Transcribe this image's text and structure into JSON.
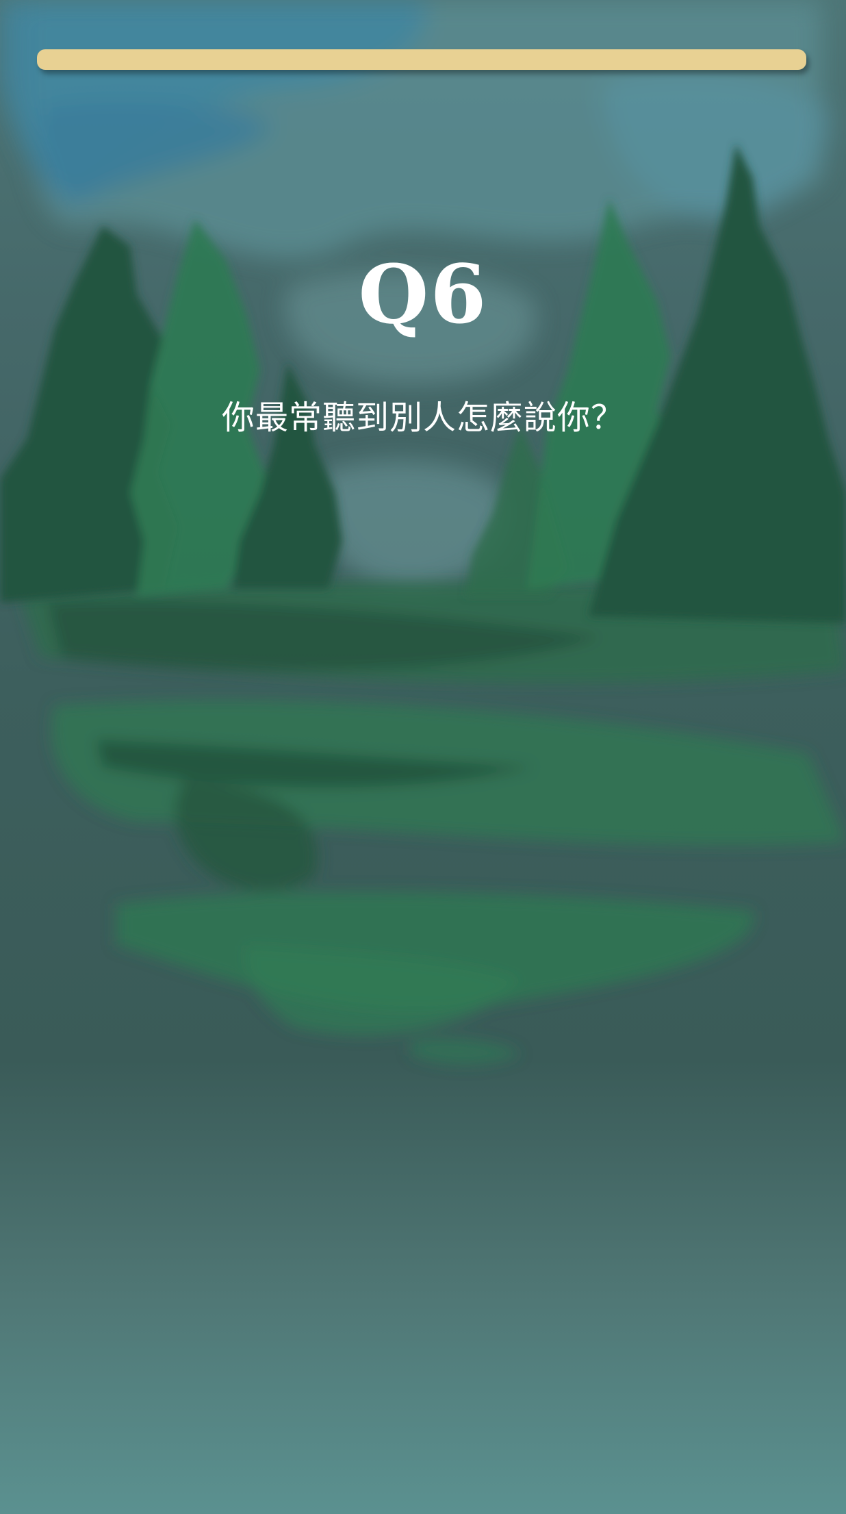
{
  "quiz": {
    "question_number": "Q6",
    "question_text": "你最常聽到別人怎麼說你？"
  },
  "progress": {
    "fraction": 1.0
  },
  "icons": {
    "background": "watercolor-forest-illustration"
  },
  "colors": {
    "progress_fill": "#e8d193",
    "text": "#ffffff",
    "sky_blue": "#3f8aa6",
    "tree_dark": "#24543f",
    "tree_light": "#2f7a53"
  }
}
